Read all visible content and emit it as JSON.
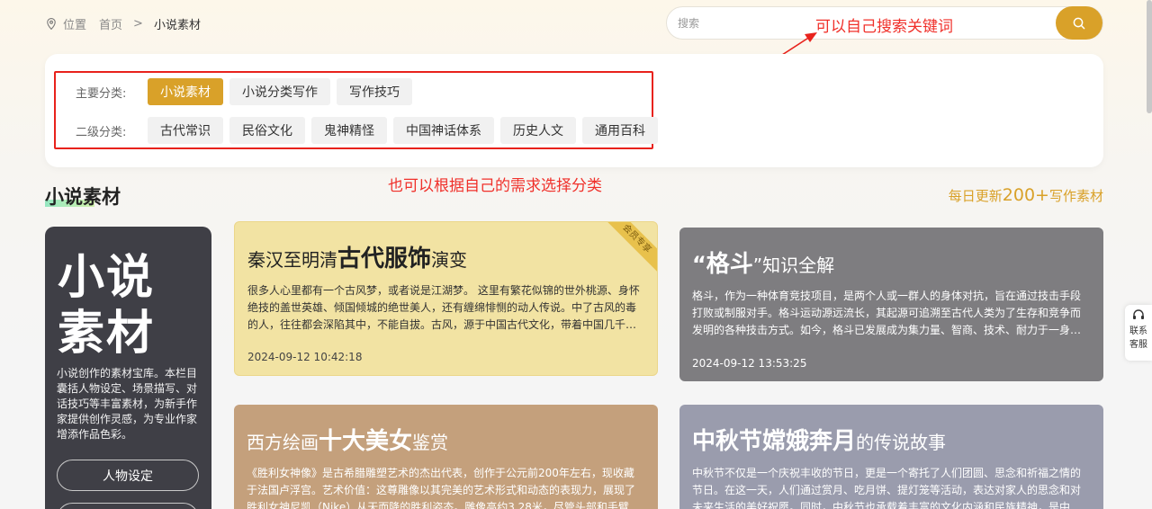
{
  "breadcrumb": {
    "location": "位置",
    "home": "首页",
    "sep": ">",
    "current": "小说素材"
  },
  "search": {
    "placeholder": "搜索"
  },
  "annotations": {
    "search_hint": "可以自己搜索关键词",
    "filter_hint": "也可以根据自己的需求选择分类"
  },
  "filters": {
    "primary_label": "主要分类:",
    "primary": [
      "小说素材",
      "小说分类写作",
      "写作技巧"
    ],
    "secondary_label": "二级分类:",
    "secondary": [
      "古代常识",
      "民俗文化",
      "鬼神精怪",
      "中国神话体系",
      "历史人文",
      "通用百科"
    ]
  },
  "section": {
    "title": "小说素材",
    "daily_prefix": "每日更新",
    "daily_count": "200+",
    "daily_suffix": "写作素材"
  },
  "sidebar": {
    "big_title_line1": "小说",
    "big_title_line2": "素材",
    "description": "小说创作的素材宝库。本栏目囊括人物设定、场景描写、对话技巧等丰富素材，为新手作家提供创作灵感，为专业作家增添作品色彩。",
    "buttons": [
      "人物设定",
      ""
    ]
  },
  "cards": [
    {
      "title_pre": "秦汉至明清",
      "title_bold": "古代服饰",
      "title_post": "演变",
      "body": "很多人心里都有一个古风梦，或者说是江湖梦。 这里有繁花似锦的世外桃源、身怀绝技的盖世英雄、倾国倾城的绝世美人，还有缠绵悱恻的动人传说。中了古风的毒的人，往往都会深陷其中，不能自拔。古风，源于中国古代文化，带着中国几千年的历史积淀。",
      "date": "2024-09-12 10:42:18",
      "ribbon": "会员专享",
      "color": "#f2e3a3"
    },
    {
      "title_pre": "“",
      "title_bold": "格斗",
      "title_post": "”知识全解",
      "body": "格斗，作为一种体育竞技项目，是两个人或一群人的身体对抗，旨在通过技击手段打败或制服对手。格斗运动源远流长，其起源可追溯至古代人类为了生存和竞争而发明的各种技击方式。如今，格斗已发展成为集力量、智商、技术、耐力于一身的暴力美学。",
      "date": "2024-09-12 13:53:25",
      "color": "#7e7d80"
    },
    {
      "title_pre": "西方绘画",
      "title_bold": "十大美女",
      "title_post": "鉴赏",
      "body": "《胜利女神像》是古希腊雕塑艺术的杰出代表，创作于公元前200年左右，现收藏于法国卢浮宫。艺术价值：这尊雕像以其完美的艺术形式和动态的表现力，展现了胜利女神尼凯（Nike）从天而降的胜利姿态。雕像高约3.28米，尽管头部和手臂已丢失，但依然美丽。",
      "color": "#c4a07c"
    },
    {
      "title_pre": "",
      "title_bold": "中秋节嫦娥奔月",
      "title_post": "的传说故事",
      "body": "中秋节不仅是一个庆祝丰收的节日，更是一个寄托了人们团圆、思念和祈福之情的节日。在这一天，人们通过赏月、吃月饼、提灯笼等活动，表达对家人的思念和对未来生活的美好祝愿。同时，中秋节也承载着丰富的文化内涵和民族精神，是中华民族的传统节日。",
      "color": "#9a9cad"
    }
  ],
  "service": {
    "line1": "联系",
    "line2": "客服"
  },
  "colors": {
    "accent": "#d9a129",
    "annotation": "#e8221c"
  }
}
